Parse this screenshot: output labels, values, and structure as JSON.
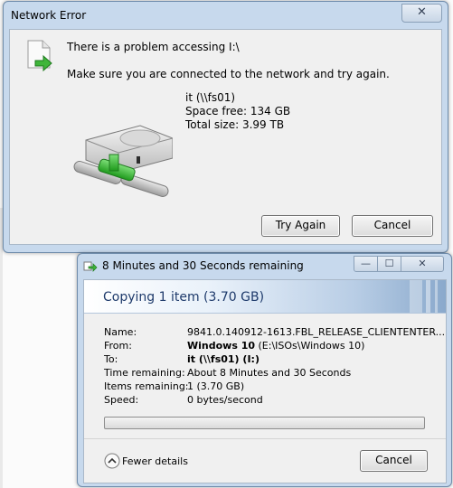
{
  "network_error": {
    "title": "Network Error",
    "close_glyph": "✕",
    "message_main": "There is a problem accessing I:\\",
    "message_hint": "Make sure you are connected to the network and try again.",
    "drive_name": "it (\\\\fs01)",
    "space_free": "Space free: 134 GB",
    "total_size": "Total size: 3.99 TB",
    "try_again_label": "Try Again",
    "cancel_label": "Cancel",
    "icons": [
      "document-icon",
      "network-drive-icon",
      "close-icon"
    ]
  },
  "copy_dialog": {
    "title": "8 Minutes and 30 Seconds remaining",
    "min_glyph": "—",
    "max_glyph": "☐",
    "close_glyph": "✕",
    "header": "Copying 1 item (3.70 GB)",
    "labels": {
      "name": "Name:",
      "from": "From:",
      "to": "To:",
      "time_remaining": "Time remaining:",
      "items_remaining": "Items remaining:",
      "speed": "Speed:"
    },
    "values": {
      "name": "9841.0.140912-1613.FBL_RELEASE_CLIENTENTER...",
      "from_bold": "Windows 10",
      "from_rest": " (E:\\ISOs\\Windows 10)",
      "to": "it (\\\\fs01) (I:)",
      "time_remaining": "About 8 Minutes and 30 Seconds",
      "items_remaining": "1 (3.70 GB)",
      "speed": "0 bytes/second"
    },
    "progress_fraction": 0.0,
    "fewer_details_label": "Fewer details",
    "cancel_label": "Cancel",
    "icons": [
      "copy-icon",
      "chevron-up-icon"
    ]
  },
  "colors": {
    "frame": "#c7d9ed",
    "client": "#f0f0f0",
    "banner_text": "#1e3a6b",
    "progress_green": "#3eb534"
  }
}
